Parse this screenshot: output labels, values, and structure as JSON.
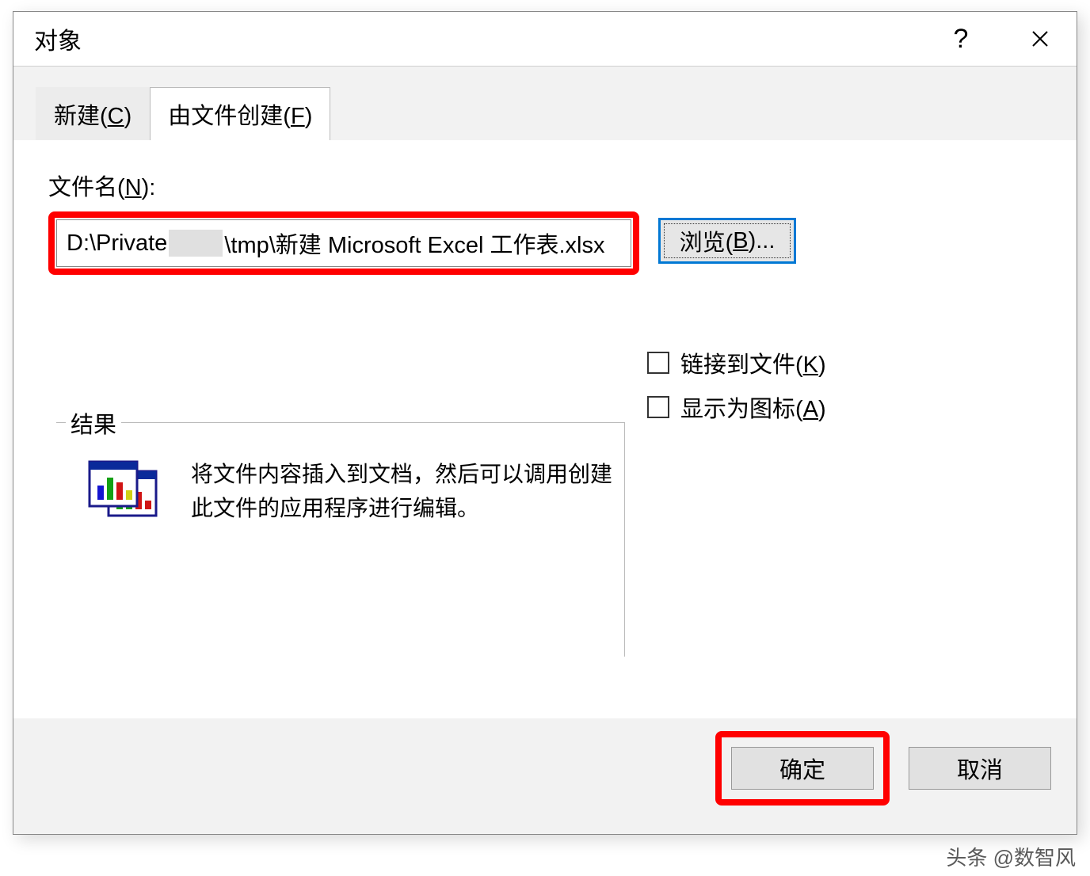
{
  "dialog": {
    "title": "对象"
  },
  "tabs": {
    "new": {
      "label_pre": "新建(",
      "ak": "C",
      "label_post": ")"
    },
    "fromFile": {
      "label_pre": "由文件创建(",
      "ak": "F",
      "label_post": ")"
    }
  },
  "filename": {
    "label_pre": "文件名(",
    "ak": "N",
    "label_post": "):",
    "value_pre": "D:\\Private",
    "value_post": "\\tmp\\新建 Microsoft Excel 工作表.xlsx"
  },
  "browse": {
    "label_pre": "浏览(",
    "ak": "B",
    "label_post": ")..."
  },
  "options": {
    "link": {
      "label_pre": "链接到文件(",
      "ak": "K",
      "label_post": ")"
    },
    "icon": {
      "label_pre": "显示为图标(",
      "ak": "A",
      "label_post": ")"
    }
  },
  "result": {
    "label": "结果",
    "text": "将文件内容插入到文档，然后可以调用创建此文件的应用程序进行编辑。"
  },
  "buttons": {
    "ok": "确定",
    "cancel": "取消"
  },
  "watermark": "头条 @数智风"
}
